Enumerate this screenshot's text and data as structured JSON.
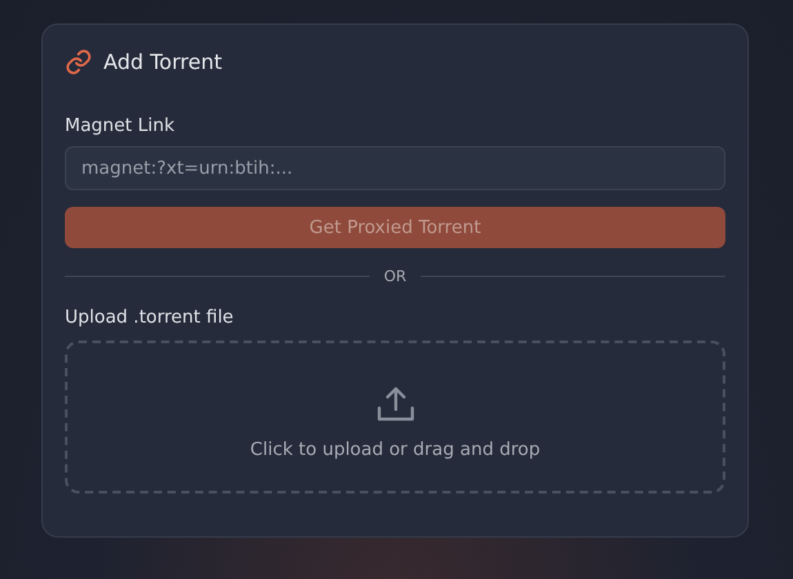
{
  "card": {
    "title": "Add Torrent"
  },
  "magnet": {
    "label": "Magnet Link",
    "placeholder": "magnet:?xt=urn:btih:..."
  },
  "button": {
    "label": "Get Proxied Torrent",
    "disabled": true
  },
  "divider": {
    "label": "OR"
  },
  "upload": {
    "label": "Upload .torrent file",
    "hint": "Click to upload or drag and drop"
  }
}
